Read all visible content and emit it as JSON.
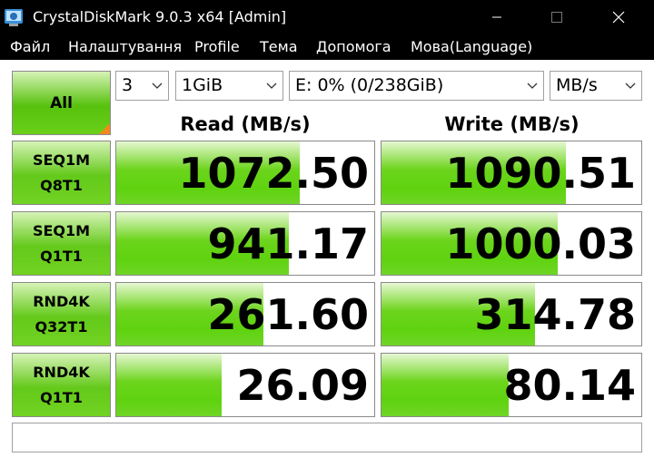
{
  "window": {
    "title": "CrystalDiskMark 9.0.3 x64 [Admin]"
  },
  "menu": [
    "Файл",
    "Налаштування",
    "Profile",
    "Тема",
    "Допомога",
    "Мова(Language)"
  ],
  "controls": {
    "all_label": "All",
    "count": "3",
    "size": "1GiB",
    "drive": "E: 0% (0/238GiB)",
    "unit": "MB/s"
  },
  "columns": {
    "read": "Read (MB/s)",
    "write": "Write (MB/s)"
  },
  "rows": [
    {
      "line1": "SEQ1M",
      "line2": "Q8T1",
      "read": "1072.50",
      "write": "1090.51",
      "read_fill": 0.71,
      "write_fill": 0.71
    },
    {
      "line1": "SEQ1M",
      "line2": "Q1T1",
      "read": "941.17",
      "write": "1000.03",
      "read_fill": 0.67,
      "write_fill": 0.68
    },
    {
      "line1": "RND4K",
      "line2": "Q32T1",
      "read": "261.60",
      "write": "314.78",
      "read_fill": 0.57,
      "write_fill": 0.59
    },
    {
      "line1": "RND4K",
      "line2": "Q1T1",
      "read": "26.09",
      "write": "80.14",
      "read_fill": 0.41,
      "write_fill": 0.49
    }
  ],
  "status": "",
  "colors": {
    "accent_green": "#5fd30f",
    "corner_orange": "#f08a1c",
    "titlebar": "#000000"
  }
}
